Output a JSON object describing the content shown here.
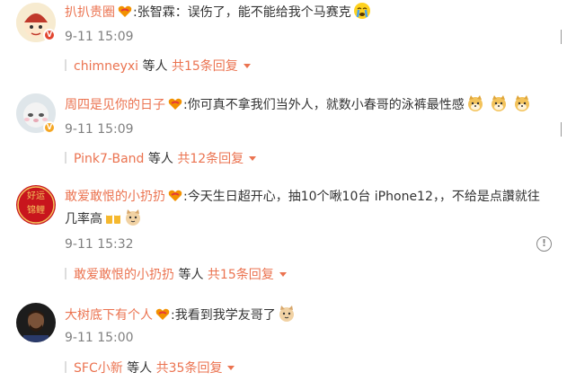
{
  "comments": [
    {
      "user": "扒扒贵圈",
      "text": ":张智霖：误伤了，能不能给我个马赛克",
      "time": "9-11 15:09",
      "reply_user": "chimneyxi",
      "reply_mid": "等人",
      "reply_total": "共15条回复"
    },
    {
      "user": "周四是见你的日子",
      "text": ":你可真不拿我们当外人，就数小春哥的泳裤最性感",
      "time": "9-11 15:09",
      "reply_user": "Pink7-Band",
      "reply_mid": "等人",
      "reply_total": "共12条回复"
    },
    {
      "user": "敢爱敢恨的小扔扔",
      "text": ":今天生日超开心，抽10个啾10台 iPhone12，，不给是点讚就往",
      "text_line2": "几率高",
      "time": "9-11 15:32",
      "reply_user": "敢爱敢恨的小扔扔",
      "reply_mid": "等人",
      "reply_total": "共15条回复"
    },
    {
      "user": "大树底下有个人",
      "text": ":我看到我学友哥了",
      "time": "9-11 15:00",
      "reply_user": "SFC小新",
      "reply_mid": "等人",
      "reply_total": "共35条回复"
    }
  ],
  "avatars": {
    "a1_text": "扒",
    "a3_text_top": "好运",
    "a3_text_bottom": "锦鲤"
  },
  "badges": {
    "verified": "V"
  },
  "icons": {
    "report": "!"
  },
  "colors": {
    "username": "#eb7350",
    "time": "#808080",
    "text": "#333333"
  }
}
